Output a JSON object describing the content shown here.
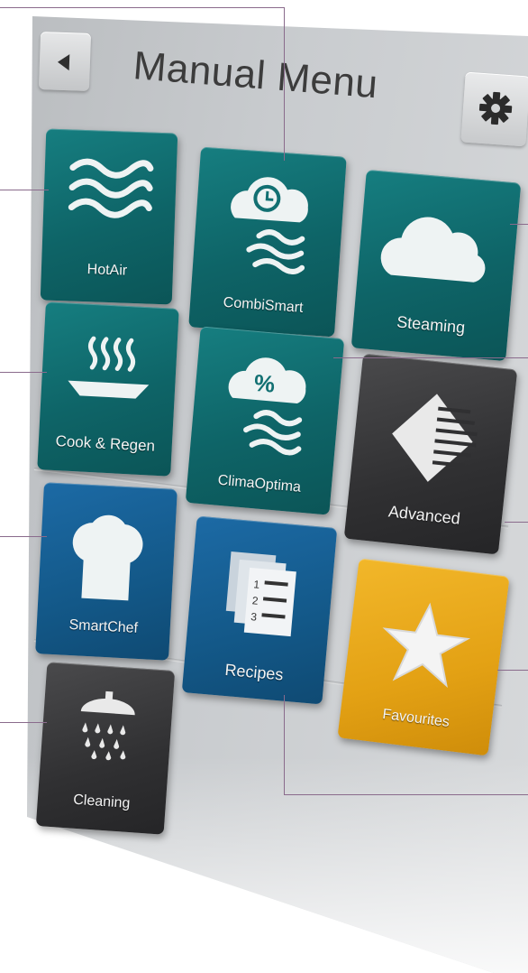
{
  "header": {
    "title": "Manual Menu",
    "back_icon": "back-arrow-icon",
    "settings_icon": "gear-icon"
  },
  "tiles": [
    {
      "label": "HotAir",
      "icon": "hot-air-waves-icon",
      "color": "#127072"
    },
    {
      "label": "CombiSmart",
      "icon": "combi-smart-cloud-clock-icon",
      "color": "#127072"
    },
    {
      "label": "Steaming",
      "icon": "steam-cloud-icon",
      "color": "#127072"
    },
    {
      "label": "Cook & Regen",
      "icon": "plate-steam-icon",
      "color": "#127072"
    },
    {
      "label": "ClimaOptima",
      "icon": "clima-cloud-percent-icon",
      "color": "#127072"
    },
    {
      "label": "Advanced",
      "icon": "advanced-diamond-icon",
      "color": "#303032"
    },
    {
      "label": "SmartChef",
      "icon": "chef-hat-icon",
      "color": "#175f93"
    },
    {
      "label": "Recipes",
      "icon": "recipe-pages-icon",
      "color": "#175f93"
    },
    {
      "label": "Favourites",
      "icon": "star-icon",
      "color": "#e3a114"
    },
    {
      "label": "Cleaning",
      "icon": "shower-icon",
      "color": "#303032"
    }
  ]
}
